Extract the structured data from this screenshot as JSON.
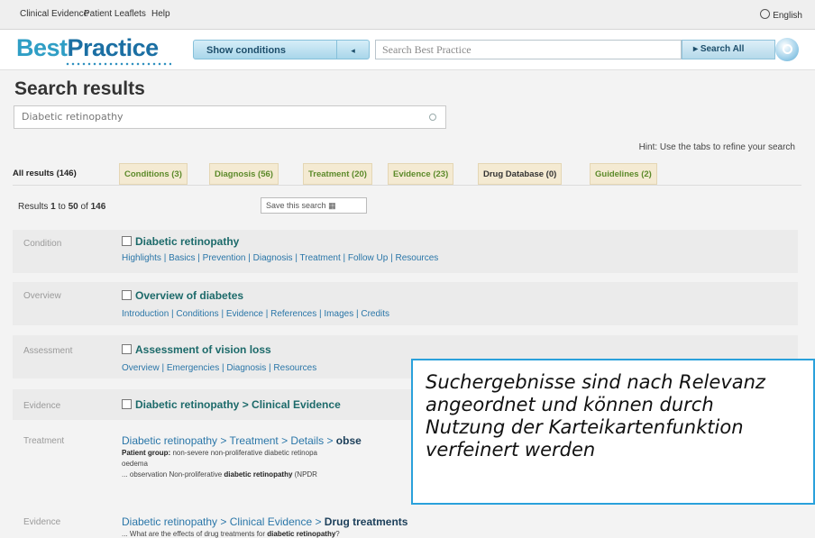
{
  "topnav": {
    "clinical_evidence": "Clinical Evidence",
    "patient_leaflets": "Patient Leaflets",
    "help": "Help",
    "language": "English"
  },
  "header": {
    "logo_best": "Best",
    "logo_practice": "Practice",
    "show_conditions": "Show conditions",
    "search_placeholder": "Search Best Practice",
    "search_all": "Search All"
  },
  "results": {
    "title": "Search results",
    "query": "Diabetic retinopathy",
    "hint": "Hint: Use the tabs to refine your search",
    "tabs": [
      "All results (146)",
      "Conditions (3)",
      "Diagnosis (56)",
      "Treatment (20)",
      "Evidence (23)",
      "Drug Database (0)",
      "Guidelines (2)"
    ],
    "count_prefix": "Results ",
    "count_from": "1",
    "count_to_label": " to ",
    "count_to": "50",
    "count_of_label": " of ",
    "count_total": "146",
    "save_search": "Save this search"
  },
  "rows": [
    {
      "type": "Condition",
      "title": "Diabetic retinopathy",
      "links": "Highlights | Basics | Prevention | Diagnosis | Treatment | Follow Up | Resources"
    },
    {
      "type": "Overview",
      "title": "Overview of diabetes",
      "links": "Introduction | Conditions | Evidence | References | Images | Credits"
    },
    {
      "type": "Assessment",
      "title": "Assessment of vision loss",
      "links": "Overview | Emergencies | Diagnosis | Resources"
    },
    {
      "type": "Evidence",
      "title": "Diabetic retinopathy > Clinical Evidence"
    },
    {
      "type": "Treatment",
      "title_plain": "Diabetic retinopathy > Treatment > Details > ",
      "title_bold": "obse",
      "snip1_bold": "Patient group:",
      "snip1": " non-severe non-proliferative diabetic retinopa",
      "snip2": "oedema",
      "snip3_pre": "... observation Non-proliferative ",
      "snip3_bold": "diabetic retinopathy",
      "snip3_post": " (NPDR"
    },
    {
      "type": "Evidence",
      "title_plain": "Diabetic retinopathy > Clinical Evidence > ",
      "title_bold": "Drug treatments",
      "snip1_pre": "... What are the effects of drug treatments for ",
      "snip1_bold": "diabetic retinopathy",
      "snip1_post": "?"
    }
  ],
  "callout": {
    "lines": [
      "Suchergebnisse sind nach Relevanz",
      "angeordnet und können durch",
      "Nutzung der Karteikartenfunktion",
      "verfeinert werden"
    ]
  }
}
